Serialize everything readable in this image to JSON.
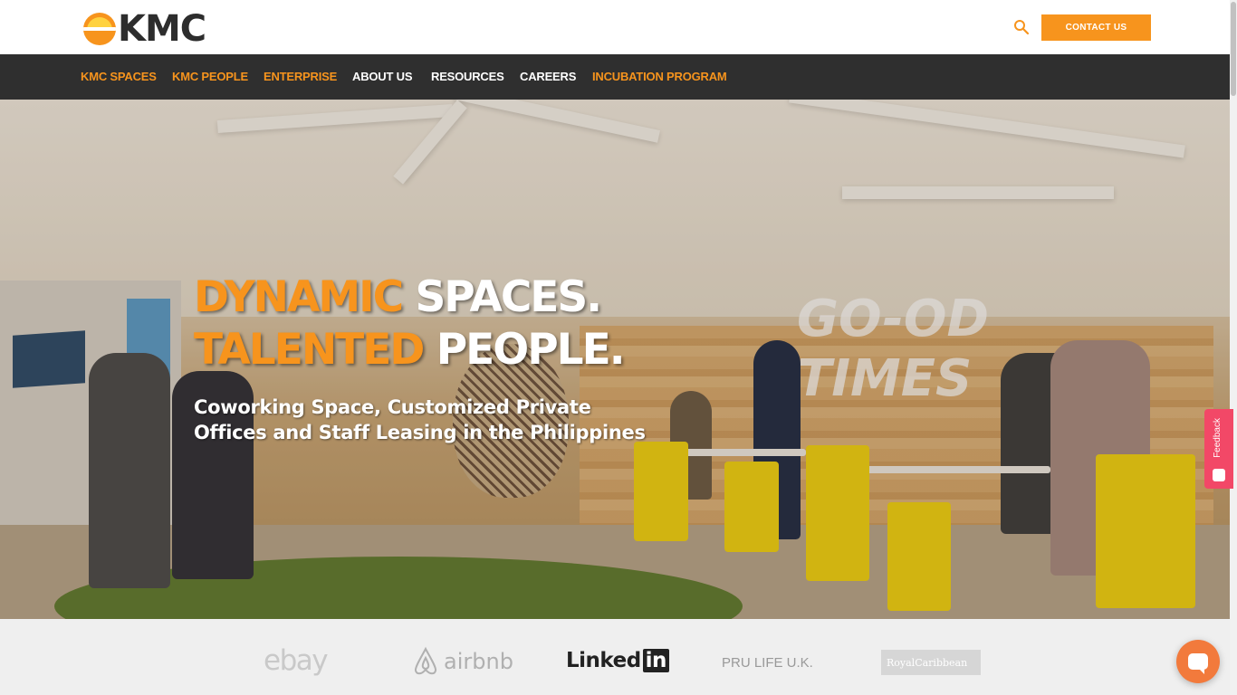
{
  "header": {
    "logo_text": "KMC",
    "contact_label": "CONTACT US",
    "search_icon": "search-icon"
  },
  "nav": {
    "items": [
      {
        "label": "KMC SPACES",
        "color": "#f7941d"
      },
      {
        "label": "KMC PEOPLE",
        "color": "#f7941d"
      },
      {
        "label": "ENTERPRISE",
        "color": "#f7941d"
      },
      {
        "label": "ABOUT US",
        "color": "#ffffff"
      },
      {
        "label": "RESOURCES",
        "color": "#ffffff"
      },
      {
        "label": "CAREERS",
        "color": "#ffffff"
      },
      {
        "label": "INCUBATION PROGRAM",
        "color": "#f7941d"
      }
    ]
  },
  "hero": {
    "line1_accent": "DYNAMIC",
    "line1_rest": " SPACES.",
    "line2_accent": "TALENTED",
    "line2_rest": " PEOPLE.",
    "subtitle": "Coworking Space, Customized Private Offices and Staff Leasing in the Philippines",
    "sign_text_1": "GO-OD",
    "sign_text_2": "TIMES"
  },
  "clients": {
    "ebay": "ebay",
    "airbnb": "airbnb",
    "linkedin_a": "Linked",
    "linkedin_b": "in",
    "pru": "PRU LIFE U.K.",
    "royal": "RoyalCaribbean"
  },
  "feedback": {
    "label": "Feedback"
  },
  "colors": {
    "accent": "#f7941d",
    "nav_bg": "#2f2f2f",
    "feedback": "#f24867",
    "chat": "#f27a3c"
  }
}
